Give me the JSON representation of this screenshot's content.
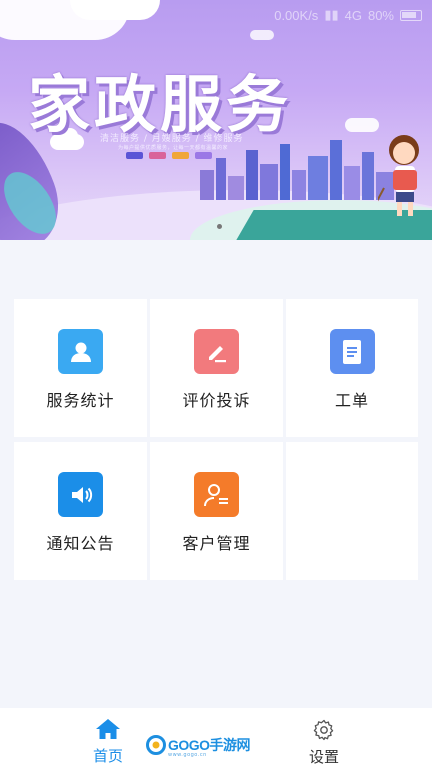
{
  "status_bar": {
    "speed": "0.00K/s",
    "network": "4G",
    "battery": "80%"
  },
  "banner": {
    "title": "家政服务",
    "subtitle": "清洁服务 / 月嫂服务 / 维修服务",
    "tagline": "为每户提供优质服务，让每一天都有温馨的家",
    "tag_colors": [
      "#5b54d6",
      "#d9639a",
      "#f0a63a",
      "#9b78e6"
    ],
    "active_slide": 1
  },
  "menu": [
    {
      "label": "服务统计",
      "icon": "person-icon",
      "color": "#3aa9f2"
    },
    {
      "label": "评价投诉",
      "icon": "pencil-edit-icon",
      "color": "#f27a7d"
    },
    {
      "label": "工单",
      "icon": "document-icon",
      "color": "#5d8ff0"
    },
    {
      "label": "通知公告",
      "icon": "speaker-icon",
      "color": "#1b8ee8"
    },
    {
      "label": "客户管理",
      "icon": "customer-list-icon",
      "color": "#f47b2a"
    }
  ],
  "tabbar": {
    "home_label": "首页",
    "settings_label": "设置",
    "active_color": "#1b8ee8"
  },
  "watermark": {
    "text": "GOGO手游网",
    "url": "www.gogo.cn"
  }
}
